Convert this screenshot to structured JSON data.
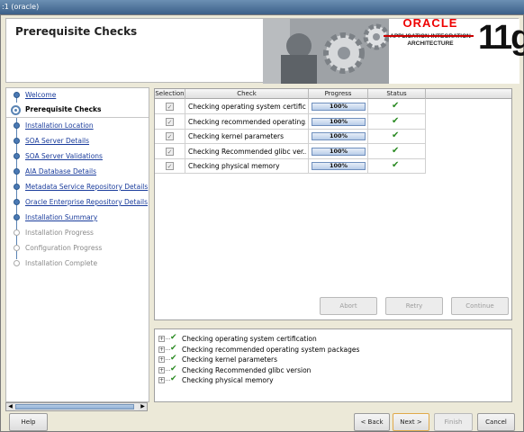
{
  "window": {
    "title": ":1 (oracle)"
  },
  "header": {
    "title": "Prerequisite Checks",
    "logo": {
      "brand": "ORACLE",
      "line1": "APPLICATION INTEGRATION",
      "line2": "ARCHITECTURE",
      "version": "11g"
    }
  },
  "sidebar": {
    "items": [
      {
        "label": "Welcome",
        "state": "link"
      },
      {
        "label": "Prerequisite Checks",
        "state": "current"
      },
      {
        "label": "Installation Location",
        "state": "link"
      },
      {
        "label": "SOA Server Details",
        "state": "link"
      },
      {
        "label": "SOA Server Validations",
        "state": "link"
      },
      {
        "label": "AIA Database Details",
        "state": "link"
      },
      {
        "label": "Metadata Service Repository Details",
        "state": "link"
      },
      {
        "label": "Oracle Enterprise Repository Details",
        "state": "link"
      },
      {
        "label": "Installation Summary",
        "state": "link"
      },
      {
        "label": "Installation Progress",
        "state": "pending"
      },
      {
        "label": "Configuration Progress",
        "state": "pending"
      },
      {
        "label": "Installation Complete",
        "state": "pending"
      }
    ]
  },
  "table": {
    "columns": [
      "Selection",
      "Check",
      "Progress",
      "Status"
    ],
    "rows": [
      {
        "check": "Checking operating system certific...",
        "progress": "100%",
        "progress_value": 1.0,
        "selected": true,
        "status": "success"
      },
      {
        "check": "Checking recommended operating...",
        "progress": "100%",
        "progress_value": 1.0,
        "selected": true,
        "status": "success"
      },
      {
        "check": "Checking kernel parameters",
        "progress": "100%",
        "progress_value": 1.0,
        "selected": true,
        "status": "success"
      },
      {
        "check": "Checking Recommended glibc ver...",
        "progress": "100%",
        "progress_value": 1.0,
        "selected": true,
        "status": "success"
      },
      {
        "check": "Checking physical memory",
        "progress": "100%",
        "progress_value": 1.0,
        "selected": true,
        "status": "success"
      }
    ]
  },
  "actions": {
    "abort": "Abort",
    "retry": "Retry",
    "continue": "Continue"
  },
  "log": {
    "items": [
      "Checking operating system certification",
      "Checking recommended operating system packages",
      "Checking kernel parameters",
      "Checking Recommended glibc version",
      "Checking physical memory"
    ]
  },
  "footer": {
    "help": "Help",
    "back": "< Back",
    "next": "Next >",
    "finish": "Finish",
    "cancel": "Cancel"
  },
  "colors": {
    "success": "#2a8a22",
    "link": "#1a3c9c",
    "oracle_red": "#e00000"
  }
}
